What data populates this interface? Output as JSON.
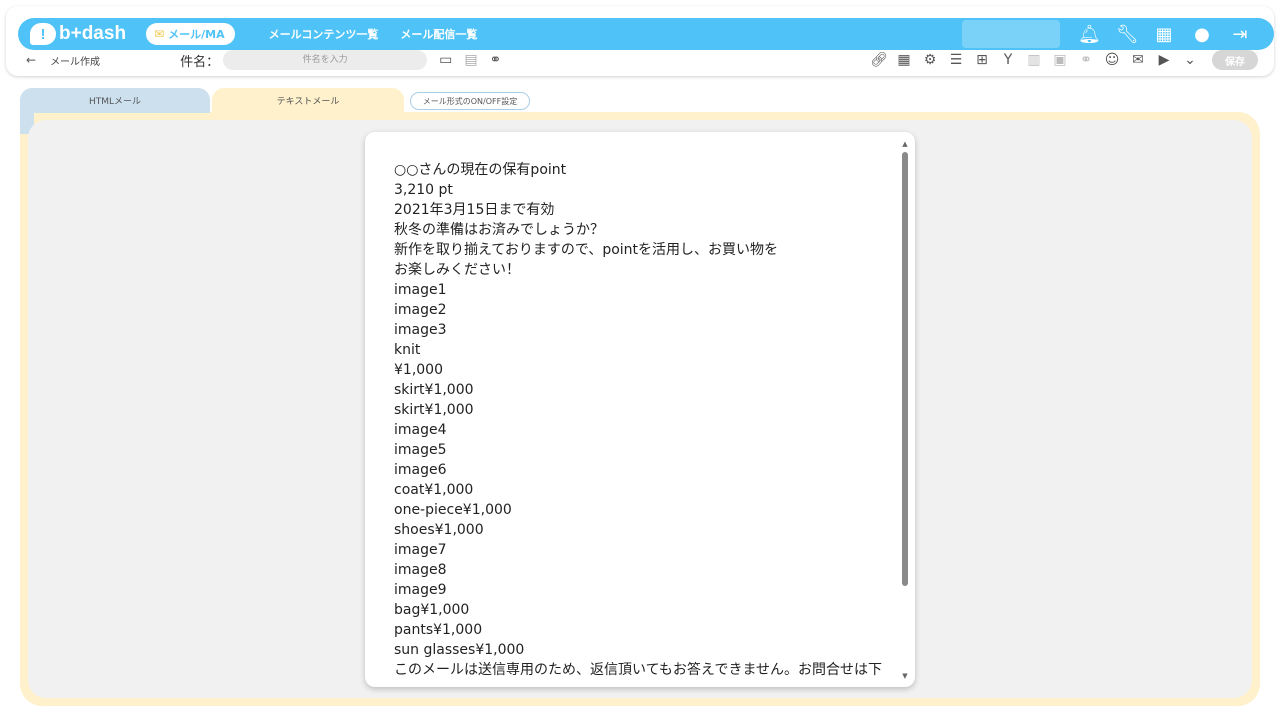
{
  "header": {
    "logo_text": "b+dash",
    "logo_mark": "!",
    "mode_label": "メール/MA",
    "nav": [
      "メールコンテンツ一覧",
      "メール配信一覧"
    ],
    "icons": [
      "bell-icon",
      "wrench-icon",
      "grid-icon",
      "chat-icon",
      "logout-icon"
    ]
  },
  "subbar": {
    "back_symbol": "←",
    "page_title": "メール作成",
    "subject_label": "件名：",
    "subject_placeholder": "件名を入力",
    "save_label": "保存"
  },
  "tabs": {
    "html_label": "HTMLメール",
    "text_label": "テキストメール",
    "toggle_label": "メール形式のON/OFF設定"
  },
  "editor": {
    "lines": [
      "○○さんの現在の保有point",
      "3,210 pt",
      "2021年3月15日まで有効",
      "秋冬の準備はお済みでしょうか？",
      "新作を取り揃えておりますので、pointを活用し、お買い物を",
      "お楽しみください！",
      "image1",
      "image2",
      "image3",
      "knit",
      "¥1,000",
      "skirt¥1,000",
      "skirt¥1,000",
      "image4",
      "image5",
      "image6",
      "coat¥1,000",
      "one-piece¥1,000",
      "shoes¥1,000",
      "image7",
      "image8",
      "image9",
      "bag¥1,000",
      "pants¥1,000",
      "sun glasses¥1,000",
      "このメールは送信専用のため、返信頂いてもお答えできません。お問合せは下"
    ]
  },
  "colors": {
    "brand_blue": "#4fc3f7",
    "tab_html_bg": "#cce0ee",
    "tab_text_bg": "#fff1cc",
    "panel_bg": "#f1f1f1"
  }
}
